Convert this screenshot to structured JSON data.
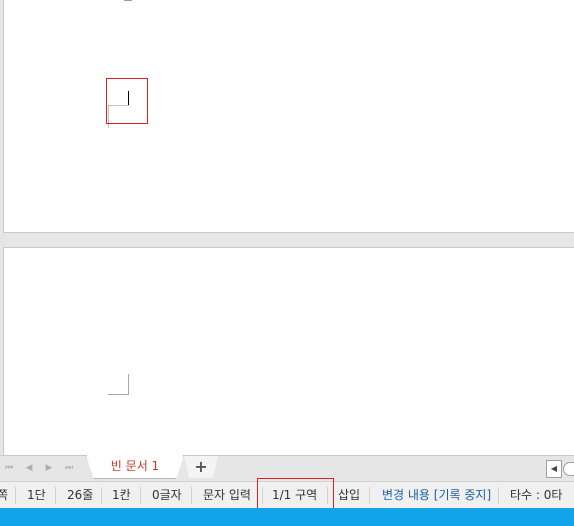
{
  "document": {
    "tab_label": "빈 문서 1",
    "add_tab_label": "+"
  },
  "tab_nav": [
    "⏮",
    "◀",
    "▶",
    "⏭"
  ],
  "status": {
    "page_partial": "쪽",
    "column": "1단",
    "line": "26줄",
    "cell": "1칸",
    "char_count": "0글자",
    "input_mode": "문자 입력",
    "section": "1/1 구역",
    "insert_mode": "삽입",
    "track_changes": "변경 내용 [기록 중지]",
    "typing_speed": "타수 : 0타"
  },
  "colors": {
    "highlight": "#e02020",
    "tab_text": "#c0392b",
    "taskbar": "#12a3e8",
    "track_changes": "#1f5fa8"
  },
  "icons": {
    "scroll_left": "◀"
  }
}
